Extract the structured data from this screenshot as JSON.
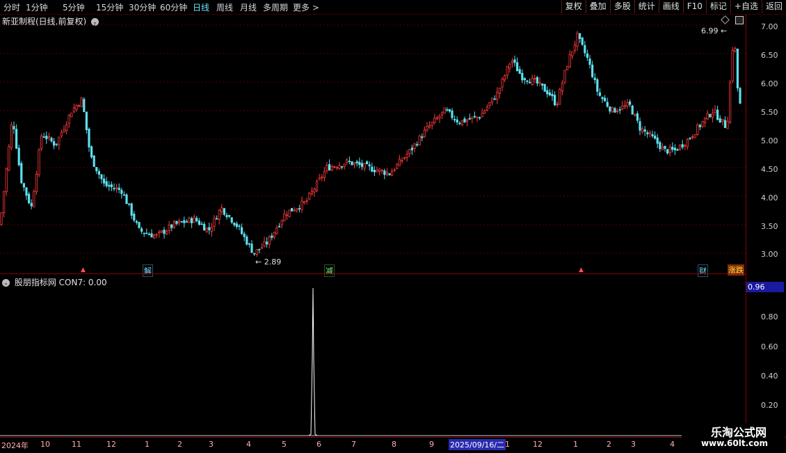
{
  "toolbar": {
    "periods": [
      "分时",
      "1分钟",
      "5分钟",
      "15分钟",
      "30分钟",
      "60分钟",
      "日线",
      "周线",
      "月线",
      "多周期",
      "更多 >"
    ],
    "active_period": "日线",
    "tools": [
      "复权",
      "叠加",
      "多股",
      "统计",
      "画线",
      "F10",
      "标记",
      "+自选",
      "返回"
    ]
  },
  "main_chart": {
    "title": "新亚制程(日线,前复权)",
    "high_label": "6.99",
    "low_label": "2.89",
    "price_ticks": [
      "7.00",
      "6.50",
      "6.00",
      "5.50",
      "5.00",
      "4.50",
      "4.00",
      "3.50",
      "3.00"
    ],
    "markers": [
      {
        "text": "解",
        "color": "#6fe0ff"
      },
      {
        "text": "减",
        "color": "#7cff7c"
      },
      {
        "text": "财",
        "color": "#6fe0ff"
      },
      {
        "text": "涨跌",
        "color": "#ffdd33"
      }
    ]
  },
  "sub_chart": {
    "title": "股朋指标网  CON7: 0.00",
    "current_value": "0.96",
    "ticks": [
      "0.80",
      "0.60",
      "0.40",
      "0.20"
    ]
  },
  "axis": {
    "months": [
      "2024年",
      "10",
      "11",
      "12",
      "1",
      "2",
      "3",
      "4",
      "5",
      "6",
      "7",
      "8",
      "9",
      "1",
      "12",
      "1",
      "2",
      "3",
      "4"
    ],
    "selected_date": "2025/09/16/二"
  },
  "watermark": {
    "title": "乐淘公式网",
    "url": "www.60lt.com"
  },
  "colors": {
    "up": "#ff3b3b",
    "down": "#5ce0f0",
    "grid": "#5a0000"
  }
}
